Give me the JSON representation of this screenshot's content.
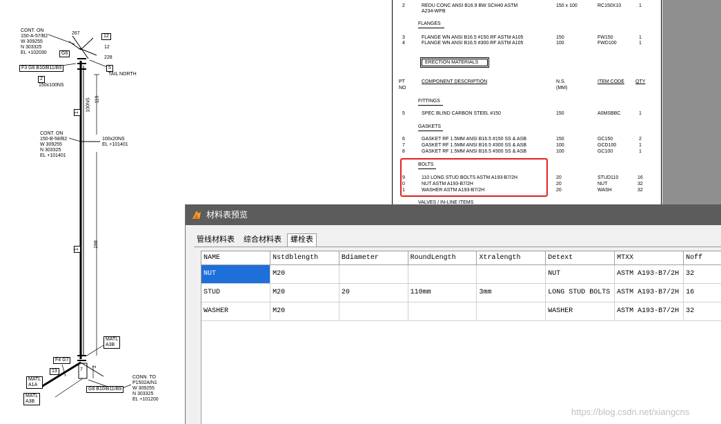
{
  "iso": {
    "labels": {
      "conn_on_1": [
        "CONT. ON",
        "150-A-57/B2",
        "W 309255",
        "N 303325",
        "EL +102030"
      ],
      "num_267": "267",
      "num_12_box": "12",
      "num_12": "12",
      "num_228": "228",
      "g6": "G6",
      "f3": "F3 G6 B10/B11/B9",
      "box_5": "5",
      "tail_north": "TAIL NORTH",
      "box_2": "2",
      "size_150x100": "150x100NS",
      "v_100ns": "100NS",
      "v_119": "119",
      "v_1": "1",
      "conn_on_2": [
        "CONT. ON",
        "150-B-58/B2",
        "W 309255",
        "N 303325",
        "EL +101401"
      ],
      "size_100x20": [
        "100x20NS",
        "EL +101401"
      ],
      "v_198": "198",
      "v_1b": "1",
      "matl_a3b": [
        "MATL",
        "A3B"
      ],
      "f4g7": "F4 G7",
      "box_13": "13",
      "matl_a1a": [
        "MATL",
        "A1A"
      ],
      "matl_a3b_2": [
        "MATL",
        "A3B"
      ],
      "g8": "G8 B10/B11/B9",
      "conn_to": [
        "CONN. TO",
        "P1502A/N1",
        "W 309255",
        "N 303325",
        "EL +101200"
      ],
      "v_2": "2",
      "v_7": "7"
    }
  },
  "sheet": {
    "row_redu": {
      "pt": "2",
      "desc1": "REDU CONC ANSI B16.9 BW SCH40 ASTM",
      "desc2": "A234-WPB",
      "ns": "150 x 100",
      "code": "RC150X10",
      "qty": "1"
    },
    "flanges_title": "FLANGES",
    "flanges": [
      {
        "pt": "3",
        "desc": "FLANGE WN ANSI B16.5 #150.RF ASTM A105",
        "ns": "150",
        "code": "FW150",
        "qty": "1"
      },
      {
        "pt": "4",
        "desc": "FLANGE WN ANSI B16.5 #300.RF ASTM A105",
        "ns": "100",
        "code": "FWD100",
        "qty": "1"
      }
    ],
    "erection_title": "ERECTION MATERIALS",
    "headers": {
      "pt": "PT",
      "no": "NO",
      "desc": "COMPONENT DESCRIPTION",
      "ns": "N.S.",
      "mm": "(MM)",
      "code": "ITEM CODE",
      "qty": "QTY"
    },
    "fittings_title": "FITTINGS",
    "fittings": [
      {
        "pt": "5",
        "desc": "SPEC BLIND CARBON STEEL #150",
        "ns": "150",
        "code": "A0MSBBC",
        "qty": "1"
      }
    ],
    "gaskets_title": "GASKETS",
    "gaskets": [
      {
        "pt": "6",
        "desc": "GASKET RF 1.5MM ANSI B16.5 #150 SS & ASB",
        "ns": "150",
        "code": "GC150",
        "qty": "2"
      },
      {
        "pt": "7",
        "desc": "GASKET RF 1.5MM ANSI B16.5 #300 SS & ASB",
        "ns": "100",
        "code": "GCD100",
        "qty": "1"
      },
      {
        "pt": "8",
        "desc": "GASKET RF 1.5MM ANSI B16.5 #300 SS & ASB",
        "ns": "100",
        "code": "GC100",
        "qty": "1"
      }
    ],
    "bolts_title": "BOLTS",
    "bolts": [
      {
        "pt": "9",
        "desc": "110 LONG STUD BOLTS ASTM A193-B7/2H",
        "ns": "20",
        "code": "STUD110",
        "qty": "16"
      },
      {
        "pt": "0",
        "desc": "NUT ASTM A193-B7/2H",
        "ns": "20",
        "code": "NUT",
        "qty": "32"
      },
      {
        "pt": "1",
        "desc": "WASHER ASTM A193-B7/2H",
        "ns": "20",
        "code": "WASH",
        "qty": "32"
      }
    ],
    "valves_title": "VALVES / IN-LINE ITEMS"
  },
  "dialog": {
    "title": "材料表预览",
    "tabs": [
      {
        "label": "管线材料表",
        "active": false
      },
      {
        "label": "综合材料表",
        "active": false
      },
      {
        "label": "螺栓表",
        "active": true
      }
    ],
    "columns": [
      "NAME",
      "Nstdblength",
      "Bdiameter",
      "RoundLength",
      "Xtralength",
      "Detext",
      "MTXX",
      "Noff"
    ],
    "rows": [
      [
        "NUT",
        "M20",
        "",
        "",
        "",
        "NUT",
        "ASTM A193-B7/2H",
        "32"
      ],
      [
        "STUD",
        "M20",
        "20",
        "110mm",
        "3mm",
        "LONG STUD BOLTS",
        "ASTM A193-B7/2H",
        "16"
      ],
      [
        "WASHER",
        "M20",
        "",
        "",
        "",
        "WASHER",
        "ASTM A193-B7/2H",
        "32"
      ]
    ]
  },
  "watermark": "https://blog.csdn.net/xiangcns",
  "colors": {
    "titlebar": "#5c5c5c",
    "selection": "#1e6fd9",
    "highlight": "#e02020",
    "side_gray": "#8f8f8f"
  }
}
